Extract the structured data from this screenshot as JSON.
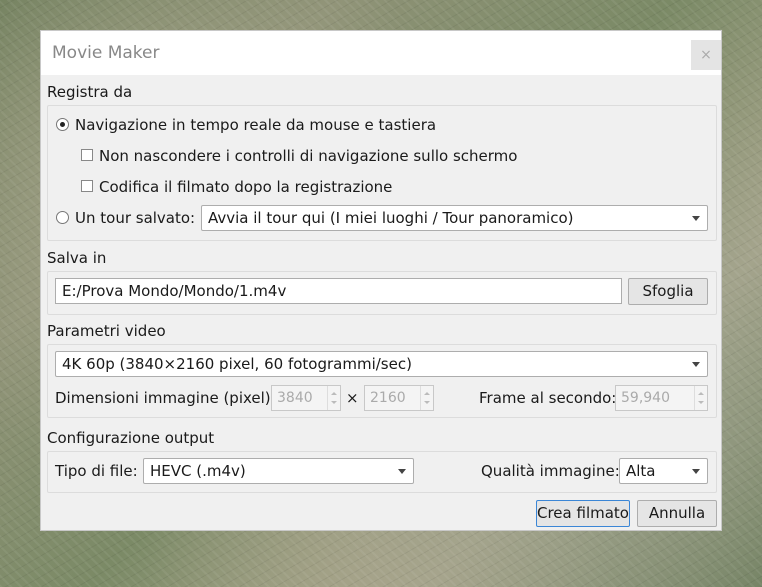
{
  "dialog": {
    "title": "Movie Maker",
    "close_icon": "close-icon",
    "close_glyph": "×"
  },
  "record_from": {
    "heading": "Registra da",
    "realtime_label": "Navigazione in tempo reale da mouse e tastiera",
    "realtime_selected": true,
    "hide_controls_label": "Non nascondere i controlli di navigazione sullo schermo",
    "hide_controls_checked": false,
    "encode_after_label": "Codifica il filmato dopo la registrazione",
    "encode_after_checked": false,
    "saved_tour_label": "Un tour salvato:",
    "saved_tour_selected": false,
    "tour_value": "Avvia il tour qui (I miei luoghi / Tour panoramico)"
  },
  "save_to": {
    "heading": "Salva in",
    "path": "E:/Prova Mondo/Mondo/1.m4v",
    "browse_label": "Sfoglia"
  },
  "video_params": {
    "heading": "Parametri video",
    "preset": "4K 60p (3840×2160 pixel, 60 fotogrammi/sec)",
    "dimensions_label": "Dimensioni immagine (pixel):",
    "width": "3840",
    "times": "×",
    "height": "2160",
    "fps_label": "Frame al secondo:",
    "fps": "59,940"
  },
  "output": {
    "heading": "Configurazione output",
    "file_type_label": "Tipo di file:",
    "file_type": "HEVC (.m4v)",
    "quality_label": "Qualità immagine:",
    "quality": "Alta"
  },
  "buttons": {
    "create": "Crea filmato",
    "cancel": "Annulla"
  }
}
